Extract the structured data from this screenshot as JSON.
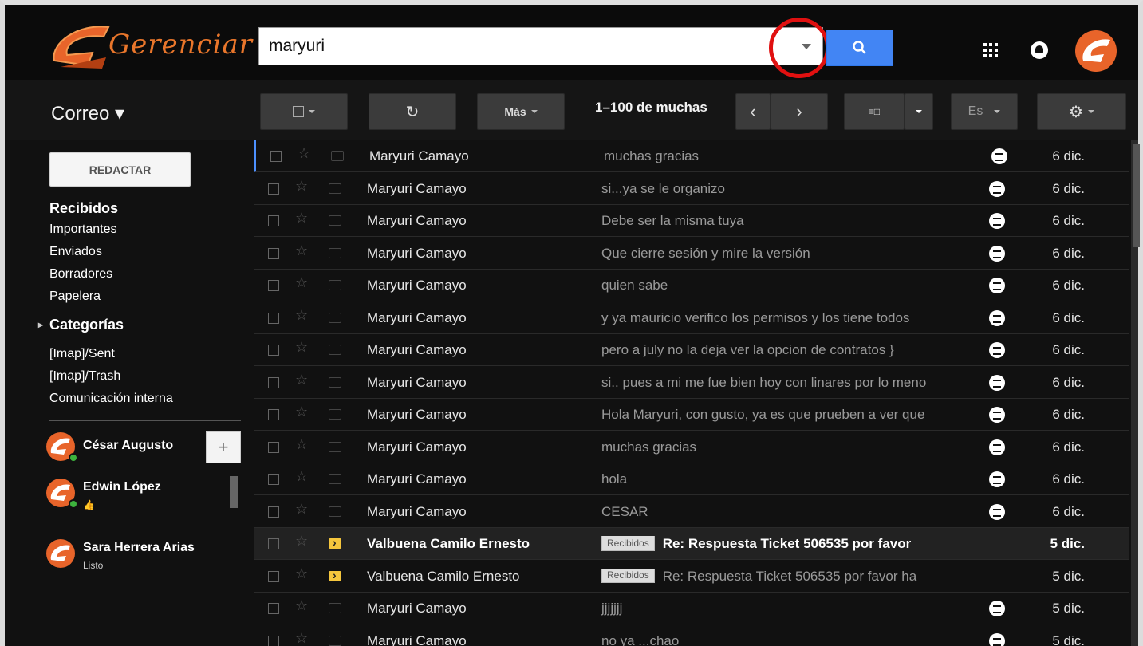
{
  "header": {
    "logo_text": "Gerenciar",
    "search_value": "maryuri",
    "search_icon": "search-icon",
    "apps_icon": "apps-grid-icon",
    "notifications_icon": "notifications-icon"
  },
  "toolbar": {
    "app_label": "Correo ▾",
    "more_label": "Más",
    "range": "1–100 de muchas",
    "refresh_icon": "refresh-icon",
    "prev_icon": "chevron-left-icon",
    "next_icon": "chevron-right-icon",
    "lang_label": "Es",
    "settings_icon": "gear-icon",
    "checkbox_icon": "checkbox-icon",
    "split_icon": "split-pane-icon"
  },
  "sidebar": {
    "compose_label": "REDACTAR",
    "items": [
      {
        "label": "Recibidos",
        "bold": true
      },
      {
        "label": "Importantes"
      },
      {
        "label": "Enviados"
      },
      {
        "label": "Borradores"
      },
      {
        "label": "Papelera"
      },
      {
        "label": "Categorías",
        "bold": true
      },
      {
        "label": "[Imap]/Sent"
      },
      {
        "label": "[Imap]/Trash"
      },
      {
        "label": "Comunicación interna"
      }
    ],
    "contacts": [
      {
        "name": "César Augusto",
        "status": ""
      },
      {
        "name": "Edwin López",
        "status": "👍"
      },
      {
        "name": "Sara Herrera Arias",
        "status": "Listo"
      }
    ],
    "add_contact_label": "+"
  },
  "messages": [
    {
      "sender": "Maryuri Camayo",
      "subject": "muchas gracias",
      "label": "",
      "date": "6 dic.",
      "unread": false,
      "chat": true
    },
    {
      "sender": "Maryuri Camayo",
      "subject": "si...ya se le organizo",
      "label": "",
      "date": "6 dic.",
      "unread": false,
      "chat": true
    },
    {
      "sender": "Maryuri Camayo",
      "subject": "Debe ser la misma tuya",
      "label": "",
      "date": "6 dic.",
      "unread": false,
      "chat": true
    },
    {
      "sender": "Maryuri Camayo",
      "subject": "Que cierre sesión y mire la versión",
      "label": "",
      "date": "6 dic.",
      "unread": false,
      "chat": true
    },
    {
      "sender": "Maryuri Camayo",
      "subject": "quien sabe",
      "label": "",
      "date": "6 dic.",
      "unread": false,
      "chat": true
    },
    {
      "sender": "Maryuri Camayo",
      "subject": "y ya mauricio verifico los permisos y los tiene todos",
      "label": "",
      "date": "6 dic.",
      "unread": false,
      "chat": true
    },
    {
      "sender": "Maryuri Camayo",
      "subject": "pero a july no la deja ver la opcion de contratos }",
      "label": "",
      "date": "6 dic.",
      "unread": false,
      "chat": true
    },
    {
      "sender": "Maryuri Camayo",
      "subject": "si.. pues a mi me fue bien hoy con linares por lo meno",
      "label": "",
      "date": "6 dic.",
      "unread": false,
      "chat": true
    },
    {
      "sender": "Maryuri Camayo",
      "subject": "Hola Maryuri, con gusto, ya es que prueben a ver que",
      "label": "",
      "date": "6 dic.",
      "unread": false,
      "chat": true
    },
    {
      "sender": "Maryuri Camayo",
      "subject": "muchas gracias",
      "label": "",
      "date": "6 dic.",
      "unread": false,
      "chat": true
    },
    {
      "sender": "Maryuri Camayo",
      "subject": "hola",
      "label": "",
      "date": "6 dic.",
      "unread": false,
      "chat": true
    },
    {
      "sender": "Maryuri Camayo",
      "subject": "CESAR",
      "label": "",
      "date": "6 dic.",
      "unread": false,
      "chat": true
    },
    {
      "sender": "Valbuena Camilo Ernesto",
      "subject": "Re: Respuesta Ticket 506535 por favor",
      "label": "Recibidos",
      "date": "5 dic.",
      "unread": true,
      "chat": false,
      "important": true
    },
    {
      "sender": "Valbuena Camilo Ernesto",
      "subject": "Re: Respuesta Ticket 506535 por favor ha",
      "label": "Recibidos",
      "date": "5 dic.",
      "unread": false,
      "chat": false,
      "important": true
    },
    {
      "sender": "Maryuri Camayo",
      "subject": "jjjjjjj",
      "label": "",
      "date": "5 dic.",
      "unread": false,
      "chat": true
    },
    {
      "sender": "Maryuri Camayo",
      "subject": "no ya ...chao",
      "label": "",
      "date": "5 dic.",
      "unread": false,
      "chat": true
    }
  ],
  "colors": {
    "accent": "#4285f4",
    "brand": "#e8642a",
    "highlight_circle": "#e01010",
    "important": "#f5c63d",
    "online": "#3db33d"
  }
}
